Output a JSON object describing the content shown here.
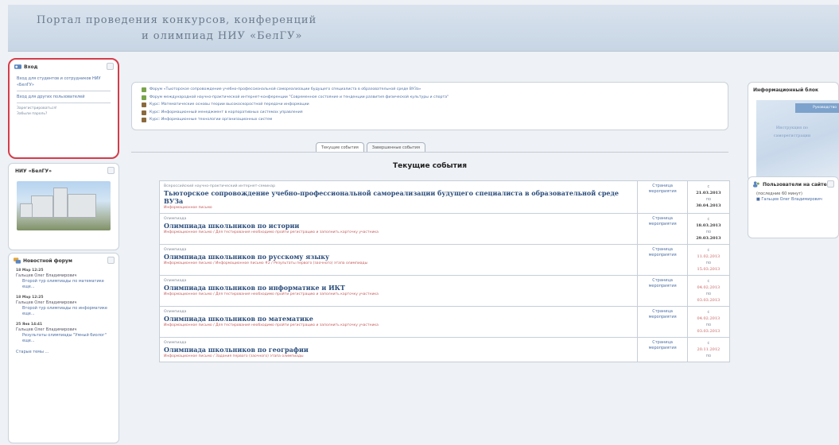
{
  "header": {
    "title_line1": "Портал проведения конкурсов, конференций",
    "title_line2": "и олимпиад НИУ «БелГУ»"
  },
  "login": {
    "title": "Вход",
    "links": [
      "Вход для студентов и сотрудников НИУ «БелГУ»",
      "Вход для других пользователей"
    ],
    "small": [
      "Зарегистрироваться!",
      "Забыли пароль?"
    ]
  },
  "uni": {
    "title": "НИУ «БелГУ»"
  },
  "news": {
    "title": "Новостной форум",
    "items": [
      {
        "date": "18 Мар 12:25",
        "author": "Гальцев Олег Владимирович",
        "text": "Второй тур олимпиады по математике еще..."
      },
      {
        "date": "18 Мар 12:25",
        "author": "Гальцев Олег Владимирович",
        "text": "Второй тур олимпиады по информатике еще..."
      },
      {
        "date": "25 Янв 14:41",
        "author": "Гальцев Олег Владимирович",
        "text": "Результаты олимпиады \"Умный биолог\" еще..."
      }
    ],
    "older": "Старые темы ..."
  },
  "courses": [
    {
      "text": "Форум «Тьюторское сопровождение учебно-профессиональной самореализации будущего специалиста в образовательной среде ВУЗа»",
      "icon_color": "#7aa44c"
    },
    {
      "text": "Форум международной научно-практической интернет-конференции \"Современное состояние и тенденции развития физической культуры и спорта\"",
      "icon_color": "#7aa44c"
    },
    {
      "text": "Курс: Математические основы теории высокоскоростной передачи информации",
      "icon_color": "#8a6a3c"
    },
    {
      "text": "Курс: Информационный менеджмент в корпоративных системах управления",
      "icon_color": "#8a6a3c"
    },
    {
      "text": "Курс: Информационные технологии организационных систем",
      "icon_color": "#8a6a3c"
    }
  ],
  "tabs": [
    "Текущие события",
    "Завершенные события"
  ],
  "events_title": "Текущие события",
  "events": [
    {
      "kind": "Всероссийский научно-практический интернет-семинар",
      "name": "Тьюторское сопровождение учебно-профессиональной самореализации будущего специалиста в образовательной среде ВУЗа",
      "links": "Информационное письмо",
      "page": "Страница мероприятия",
      "from_label": "с",
      "date_from": "21.03.2013",
      "to_label": "по",
      "date_to": "30.04.2013",
      "date_color": "black"
    },
    {
      "kind": "Олимпиада",
      "name": "Олимпиада школьников по истории",
      "links": "Информационное письмо / Для тестирования необходимо пройти регистрацию и заполнить карточку участника",
      "page": "Страница мероприятия",
      "from_label": "с",
      "date_from": "18.03.2013",
      "to_label": "по",
      "date_to": "29.03.2013",
      "date_color": "black"
    },
    {
      "kind": "Олимпиада",
      "name": "Олимпиада школьников по русскому языку",
      "links": "Информационное письмо / Информационное письмо #2 / Результаты первого (заочного) этапа олимпиады",
      "page": "Страница мероприятия",
      "from_label": "с",
      "date_from": "11.02.2013",
      "to_label": "по",
      "date_to": "15.03.2013",
      "date_color": "red"
    },
    {
      "kind": "Олимпиада",
      "name": "Олимпиада школьников по информатике и ИКТ",
      "links": "Информационное письмо / Для тестирования необходимо пройти регистрацию и заполнить карточку участника",
      "page": "Страница мероприятия",
      "from_label": "с",
      "date_from": "04.02.2013",
      "to_label": "по",
      "date_to": "03.03.2013",
      "date_color": "red"
    },
    {
      "kind": "Олимпиада",
      "name": "Олимпиада школьников по математике",
      "links": "Информационное письмо / Для тестирования необходимо пройти регистрацию и заполнить карточку участника",
      "page": "Страница мероприятия",
      "from_label": "с",
      "date_from": "04.02.2013",
      "to_label": "по",
      "date_to": "03.03.2013",
      "date_color": "red"
    },
    {
      "kind": "Олимпиада",
      "name": "Олимпиада школьников по географии",
      "links": "Информационное письмо / Задания первого (заочного) этапа олимпиады",
      "page": "Страница мероприятия",
      "from_label": "с",
      "date_from": "20.11.2012",
      "to_label": "по",
      "date_to": "",
      "date_color": "red"
    }
  ],
  "info": {
    "title": "Информационный блок",
    "banner_top": "Руководство",
    "banner_text": "Инструкция по саморегистрации"
  },
  "users": {
    "title": "Пользователи на сайте",
    "note": "(последние 60 минут)",
    "user": "Гальцев Олег Владимирович"
  }
}
